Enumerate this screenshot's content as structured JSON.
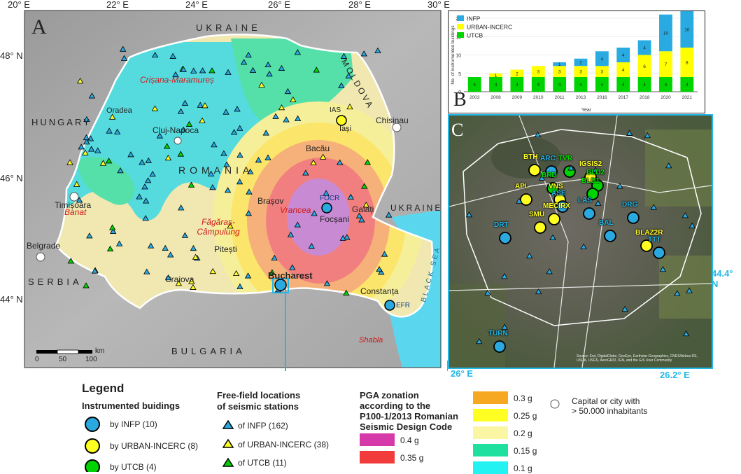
{
  "map_a": {
    "panel_label": "A",
    "lon_labels": [
      "20° E",
      "22° E",
      "24° E",
      "26° E",
      "28° E",
      "30° E"
    ],
    "lat_labels": [
      "48° N",
      "46° N",
      "44° N"
    ],
    "countries": [
      "UKRAINE",
      "MOLDOVA",
      "HUNGARY",
      "ROMANIA",
      "UKRAINE",
      "SERBIA",
      "BULGARIA"
    ],
    "sea": "BLACK SEA",
    "regions": [
      "Crișana-Maramureș",
      "Banat",
      "Făgăraș-Câmpulung",
      "Vrancea",
      "Shabla"
    ],
    "cities": [
      "Oradea",
      "Cluj-Napoca",
      "Timișoara",
      "Belgrade",
      "Brașov",
      "Pitești",
      "Craiova",
      "Bucharest",
      "Chisinau",
      "Iași",
      "Bacău",
      "Focșani",
      "Galați",
      "Constanța"
    ],
    "station_codes": [
      "IAS",
      "FOCR",
      "EFR"
    ],
    "scale": {
      "unit": "km",
      "ticks": [
        "0",
        "50",
        "100"
      ]
    }
  },
  "chart_b": {
    "panel_label": "B",
    "legend": [
      "INFP",
      "URBAN-INCERC",
      "UTCB"
    ],
    "colors": {
      "INFP": "#29abe2",
      "URBAN": "#ffff00",
      "UTCB": "#00d400"
    }
  },
  "chart_data": {
    "type": "bar",
    "stacked": true,
    "categories": [
      "2003",
      "2008",
      "2009",
      "2010",
      "2011",
      "2013",
      "2016",
      "2017",
      "2018",
      "2020",
      "2021"
    ],
    "series": [
      {
        "name": "UTCB",
        "values": [
          4,
          4,
          4,
          4,
          4,
          4,
          4,
          4,
          4,
          4,
          4
        ]
      },
      {
        "name": "URBAN-INCERC",
        "values": [
          0,
          1,
          2,
          3,
          3,
          3,
          3,
          4,
          6,
          7,
          8
        ]
      },
      {
        "name": "INFP",
        "values": [
          0,
          0,
          0,
          0,
          1,
          2,
          4,
          4,
          4,
          10,
          10
        ]
      }
    ],
    "xlabel": "Year",
    "ylabel": "No. of instrumented buildings",
    "ylim": [
      0,
      20
    ],
    "yticks": [
      "0",
      "5",
      "10",
      "15",
      "20"
    ]
  },
  "map_c": {
    "panel_label": "C",
    "coord_labels": [
      "26° E",
      "26.2° E",
      "44.4° N"
    ],
    "buildings": [
      {
        "code": "BTH",
        "org": "urban"
      },
      {
        "code": "ARC",
        "org": "infp"
      },
      {
        "code": "TVR",
        "org": "utcb"
      },
      {
        "code": "IGSIS2",
        "org": "urban"
      },
      {
        "code": "BLD2",
        "org": "utcb"
      },
      {
        "code": "BLD1",
        "org": "utcb"
      },
      {
        "code": "BRD",
        "org": "utcb"
      },
      {
        "code": "VNS",
        "org": "urban"
      },
      {
        "code": "APL",
        "org": "urban"
      },
      {
        "code": "ASE",
        "org": "infp"
      },
      {
        "code": "LAS",
        "org": "infp"
      },
      {
        "code": "DRG",
        "org": "infp"
      },
      {
        "code": "MECIRX",
        "org": "urban"
      },
      {
        "code": "SMU",
        "org": "urban"
      },
      {
        "code": "DRT",
        "org": "infp"
      },
      {
        "code": "BAL",
        "org": "infp"
      },
      {
        "code": "BLAZ2R",
        "org": "urban"
      },
      {
        "code": "TTT",
        "org": "infp"
      },
      {
        "code": "TURN",
        "org": "infp"
      }
    ],
    "attribution": "Source: Esri, DigitalGlobe, GeoEye, Earthstar Geographics, CNES/Airbus DS, USDA, USGS, AeroGRID, IGN, and the GIS User Community"
  },
  "legend": {
    "title": "Legend",
    "buildings_title": "Instrumented buidings",
    "buildings": [
      "by INFP (10)",
      "by URBAN-INCERC (8)",
      "by UTCB (4)"
    ],
    "freefield_title_1": "Free-field locations",
    "freefield_title_2": "of seismic stations",
    "freefield": [
      "of INFP (162)",
      "of URBAN-INCERC (38)",
      "of UTCB (11)"
    ],
    "pga_title_1": "PGA zonation",
    "pga_title_2": "according to the",
    "pga_title_3": "P100-1/2013 Romanian",
    "pga_title_4": "Seismic Design Code",
    "pga": [
      {
        "label": "0.4 g",
        "color": "#d63aa8"
      },
      {
        "label": "0.35 g",
        "color": "#f23b3b"
      },
      {
        "label": "0.3 g",
        "color": "#f7a823"
      },
      {
        "label": "0.25 g",
        "color": "#ffff22"
      },
      {
        "label": "0.2 g",
        "color": "#fbf6a4"
      },
      {
        "label": "0.15 g",
        "color": "#20e0a0"
      },
      {
        "label": "0.1 g",
        "color": "#22f2f2"
      }
    ],
    "city_note_1": "Capital or city with",
    "city_note_2": "> 50.000 inhabitants"
  }
}
